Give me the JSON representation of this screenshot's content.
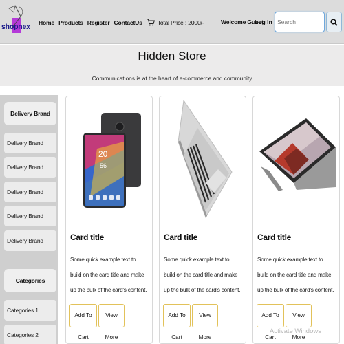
{
  "navbar": {
    "logo_text": "shopnex",
    "links": [
      "Home",
      "Products",
      "Register",
      "ContactUs"
    ],
    "cart_icon": "cart-icon",
    "total_price": "Total Price : 2000/-",
    "welcome": "Welcome Guest",
    "login": "Log In",
    "search_placeholder": "Search",
    "search_icon": "search-icon"
  },
  "hero": {
    "title": "Hidden Store",
    "subtitle": "Communications is at the heart of e-commerce and community"
  },
  "sidebar": {
    "delivery_header": "Delivery Brand",
    "delivery_items": [
      "Delivery Brand",
      "Delivery Brand",
      "Delivery Brand",
      "Delivery Brand",
      "Delivery Brand"
    ],
    "categories_header": "Categories",
    "category_items": [
      "Categories 1",
      "Categories 2"
    ]
  },
  "cards": [
    {
      "image": "tablet-image",
      "title": "Card title",
      "text": "Some quick example text to build on the card title and make up the bulk of the card's content.",
      "add_label": "Add To Cart",
      "view_label": "View More"
    },
    {
      "image": "laptop-image",
      "title": "Card title",
      "text": "Some quick example text to build on the card title and make up the bulk of the card's content.",
      "add_label": "Add To Cart",
      "view_label": "View More"
    },
    {
      "image": "surface-image",
      "title": "Card title",
      "text": "Some quick example text to build on the card title and make up the bulk of the card's content.",
      "add_label": "Add To Cart",
      "view_label": "View More"
    }
  ],
  "watermark": "Activate Windows",
  "colors": {
    "navbar": "#dcdcdc",
    "hero": "#ecebeb",
    "sidebar": "#cfcfcf",
    "button_border": "#e2c25a",
    "search_border": "#6fa8dc"
  }
}
